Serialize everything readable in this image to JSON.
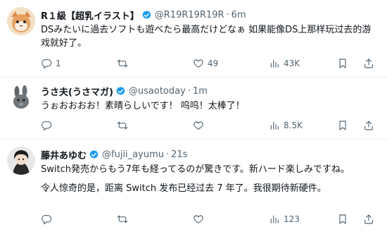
{
  "tweets": [
    {
      "name": "R１級【超乳イラスト】",
      "handle": "@R19R19R19R",
      "time": "6m",
      "lines": [
        "DSみたいに過去ソフトも遊べたら最高だけどなぁ 如果能像DS上那样玩过去的游戏就好了。"
      ],
      "stats": {
        "replies": "1",
        "retweets": "",
        "likes": "49",
        "views": "43K"
      }
    },
    {
      "name": "うさ夫(うさマガ)",
      "handle": "@usaotoday",
      "time": "1m",
      "lines": [
        "うぉおおおお！素晴らしいです！ 呜呜！太棒了！"
      ],
      "stats": {
        "replies": "",
        "retweets": "",
        "likes": "",
        "views": "8.5K"
      }
    },
    {
      "name": "藤井あゆむ",
      "handle": "@fujii_ayumu",
      "time": "21s",
      "lines": [
        "Switch発売からもう7年も経ってるのが驚きです。新ハード楽しみですね。",
        "令人惊奇的是，距离 Switch 发布已经过去 7 年了。我很期待新硬件。"
      ],
      "stats": {
        "replies": "",
        "retweets": "",
        "likes": "",
        "views": "123"
      }
    }
  ],
  "separator": "·",
  "icons": [
    "reply-icon",
    "retweet-icon",
    "like-icon",
    "views-icon",
    "bookmark-icon",
    "share-icon",
    "verified-badge-icon"
  ],
  "colors": {
    "verified": "#1d9bf0",
    "text": "#0f1419",
    "muted": "#536471",
    "divider": "#eff3f4"
  }
}
